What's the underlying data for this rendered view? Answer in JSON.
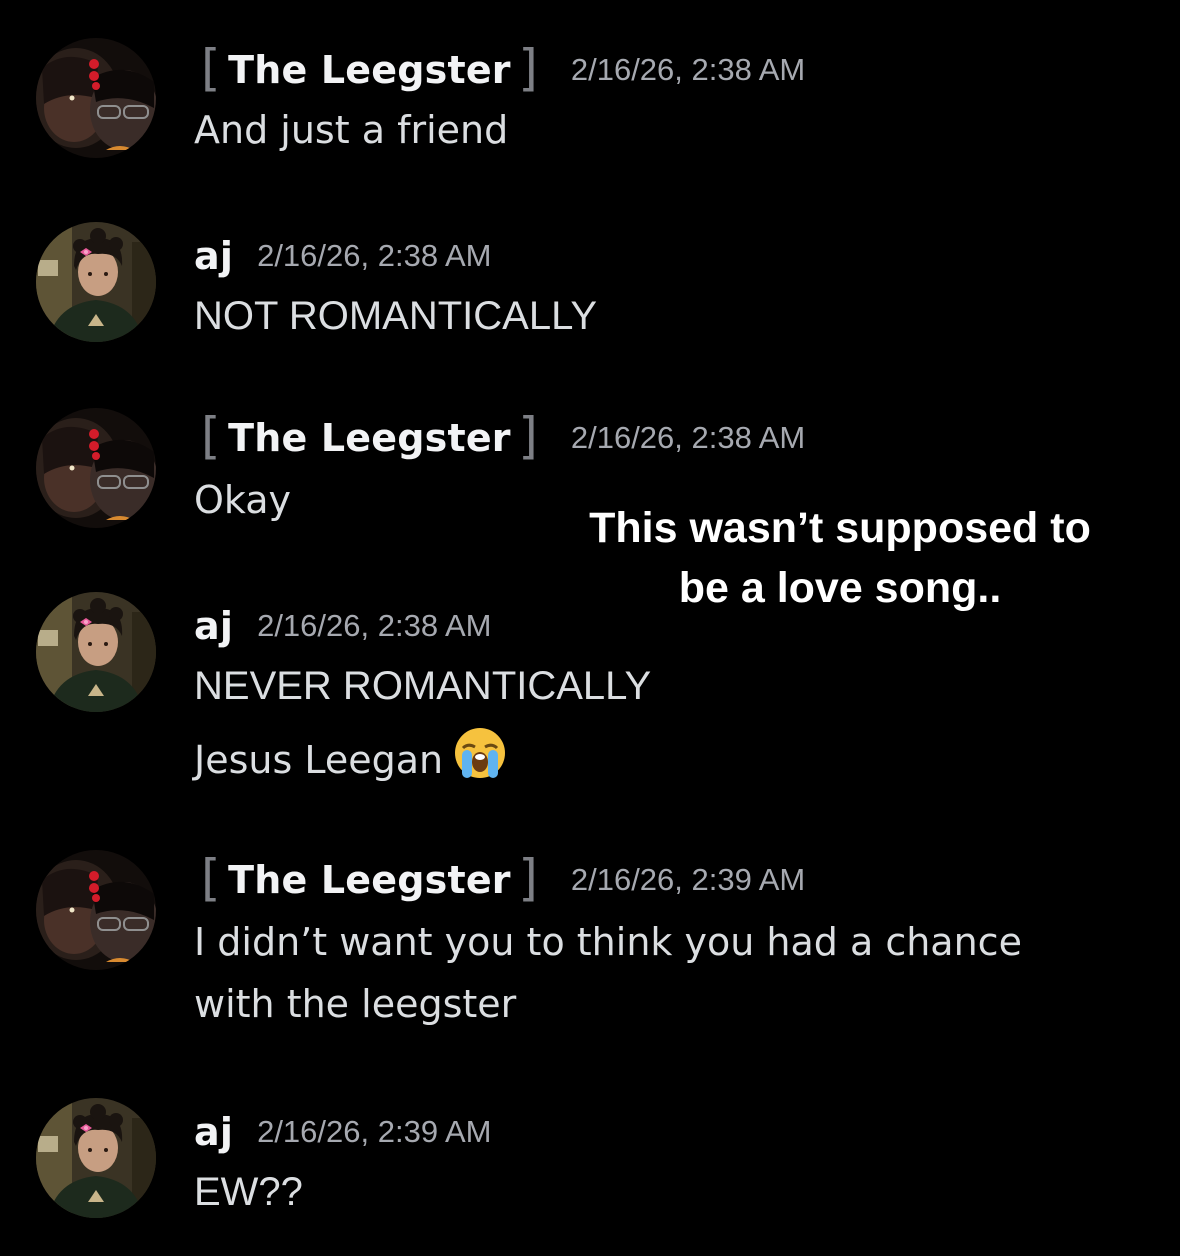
{
  "colors": {
    "background": "#000000",
    "username": "#f2f3f5",
    "message_text": "#dbdee1",
    "timestamp": "#a6a9b0",
    "bracket": "#7d7f85"
  },
  "overlay_caption": {
    "line1": "This wasn’t supposed to",
    "line2": "be a love song.."
  },
  "messages": [
    {
      "author": "The Leegster",
      "timestamp": "2/16/26, 2:38 AM",
      "avatar_icon": "leegster-avatar-icon",
      "lines": [
        "And just a friend"
      ]
    },
    {
      "author": "aj",
      "timestamp": "2/16/26, 2:38 AM",
      "avatar_icon": "aj-avatar-icon",
      "lines": [
        "NOT ROMANTICALLY"
      ]
    },
    {
      "author": "The Leegster",
      "timestamp": "2/16/26, 2:38 AM",
      "avatar_icon": "leegster-avatar-icon",
      "lines": [
        "Okay"
      ]
    },
    {
      "author": "aj",
      "timestamp": "2/16/26, 2:38 AM",
      "avatar_icon": "aj-avatar-icon",
      "lines": [
        "NEVER ROMANTICALLY",
        "Jesus Leegan"
      ],
      "emoji": "loudly-crying-face-icon"
    },
    {
      "author": "The Leegster",
      "timestamp": "2/16/26, 2:39 AM",
      "avatar_icon": "leegster-avatar-icon",
      "lines": [
        "I didn’t want you to think you had a chance",
        "with the leegster"
      ]
    },
    {
      "author": "aj",
      "timestamp": "2/16/26, 2:39 AM",
      "avatar_icon": "aj-avatar-icon",
      "lines": [
        "EW??"
      ]
    }
  ]
}
